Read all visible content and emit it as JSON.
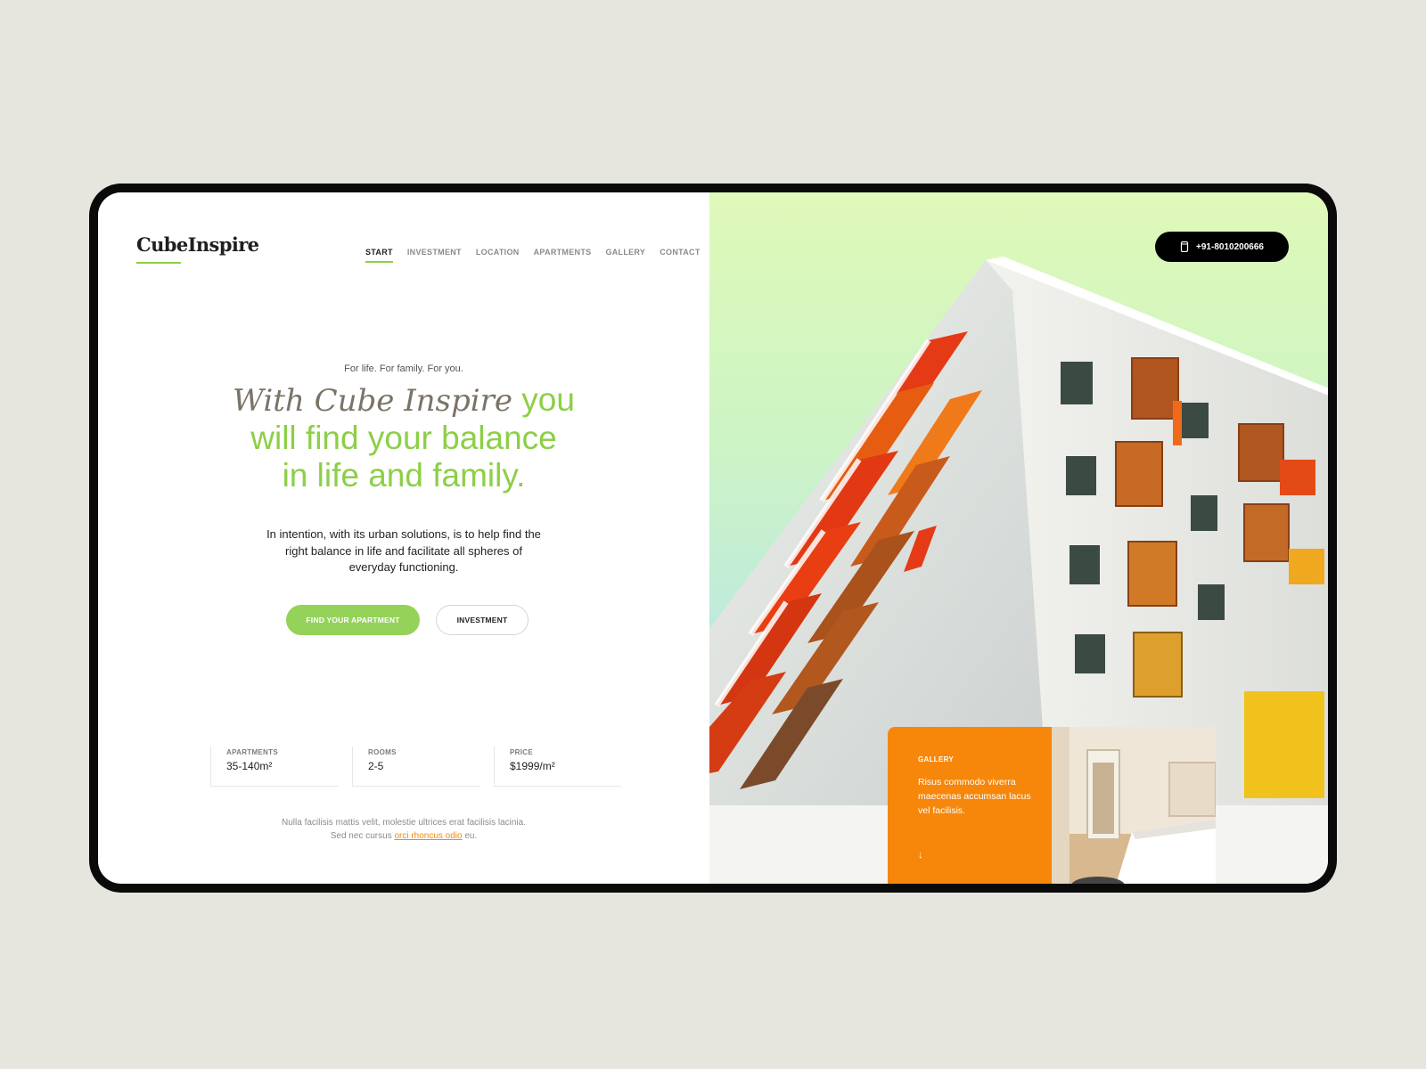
{
  "brand": {
    "logo": "CubeInspire",
    "accent": "#8ccf47"
  },
  "nav": {
    "items": [
      {
        "label": "START",
        "active": true
      },
      {
        "label": "INVESTMENT"
      },
      {
        "label": "LOCATION"
      },
      {
        "label": "APARTMENTS"
      },
      {
        "label": "GALLERY"
      },
      {
        "label": "CONTACT"
      }
    ]
  },
  "hero": {
    "tagline": "For life. For family. For you.",
    "headline_brand": "With Cube Inspire",
    "headline_rest_1": " you",
    "headline_rest_2": "will find your balance",
    "headline_rest_3": "in life and family.",
    "description": "In intention, with its urban solutions, is to help find the right balance in life and facilitate all spheres of everyday functioning.",
    "primary_button": "FIND YOUR APARTMENT",
    "secondary_button": "INVESTMENT"
  },
  "stats": [
    {
      "label": "APARTMENTS",
      "value": "35-140m²"
    },
    {
      "label": "ROOMS",
      "value": "2-5"
    },
    {
      "label": "PRICE",
      "value": "$1999/m²"
    }
  ],
  "footnote": {
    "line1": "Nulla facilisis mattis velit, molestie ultrices erat facilisis lacinia.",
    "line2_before": "Sed nec cursus ",
    "line2_link": "orci rhoncus odio",
    "line2_after": " eu."
  },
  "contact": {
    "phone": "+91-8010200666",
    "icon": "phone-icon"
  },
  "gallery": {
    "label": "GALLERY",
    "text": "Risus commodo viverra maecenas accumsan lacus vel facilisis.",
    "arrow": "↓",
    "color": "#f6870a"
  }
}
